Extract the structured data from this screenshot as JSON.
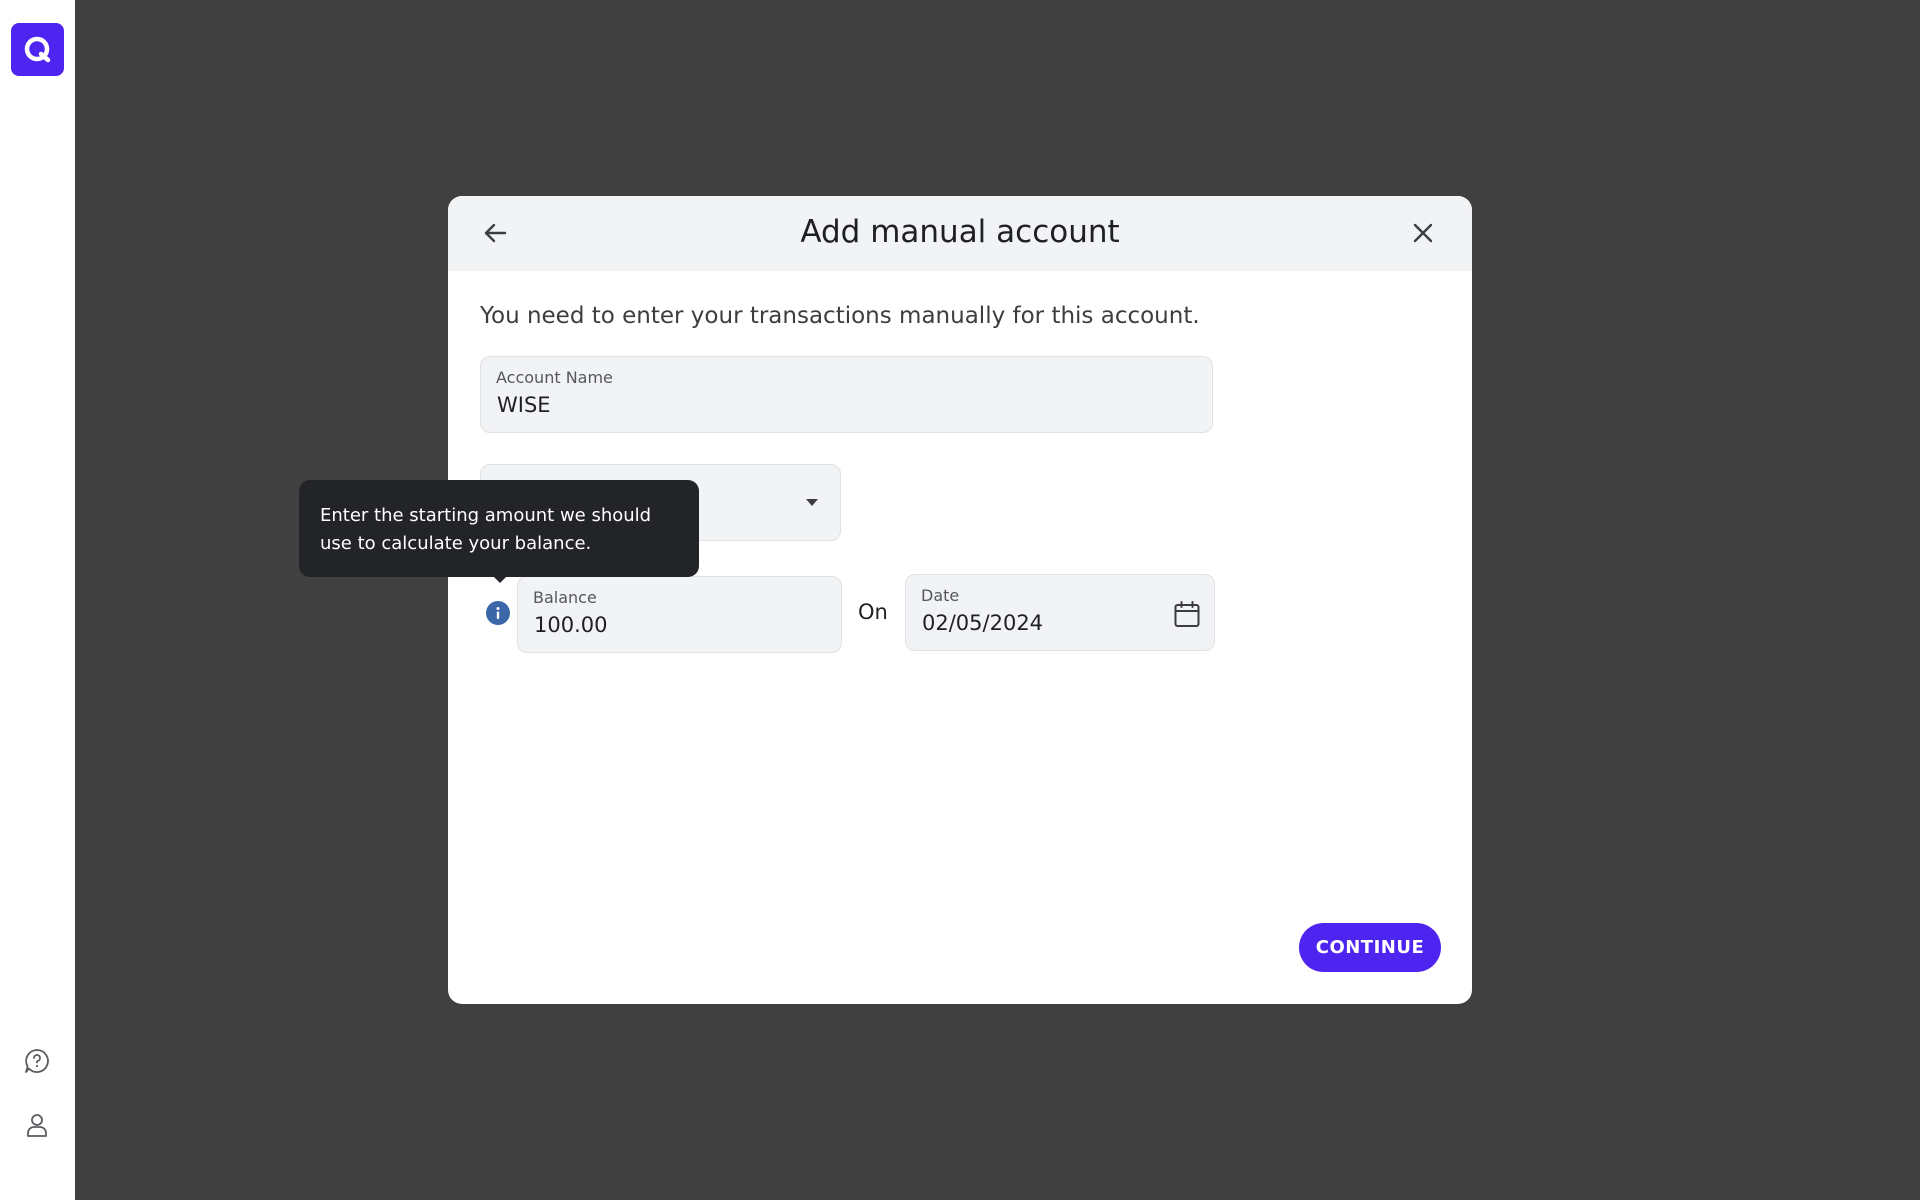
{
  "sidebar": {
    "logo": "app-logo",
    "help_icon": "help-chat-icon",
    "profile_icon": "profile-icon"
  },
  "modal": {
    "title": "Add manual account",
    "back_icon": "arrow-left-icon",
    "close_icon": "close-icon",
    "subtitle": "You need to enter your transactions manually for this account.",
    "account_name": {
      "label": "Account Name",
      "value": "WISE"
    },
    "account_type": {
      "value": ""
    },
    "balance": {
      "label": "Balance",
      "value": "100.00"
    },
    "on_label": "On",
    "date": {
      "label": "Date",
      "value": "02/05/2024",
      "icon": "calendar-icon"
    },
    "continue_label": "CONTINUE"
  },
  "tooltip": {
    "line1": "Enter the starting amount we should",
    "line2": "use to calculate your balance."
  },
  "colors": {
    "accent": "#4e25f0",
    "info": "#3b67a9",
    "backdrop": "#404040",
    "tooltip_bg": "#222428"
  }
}
